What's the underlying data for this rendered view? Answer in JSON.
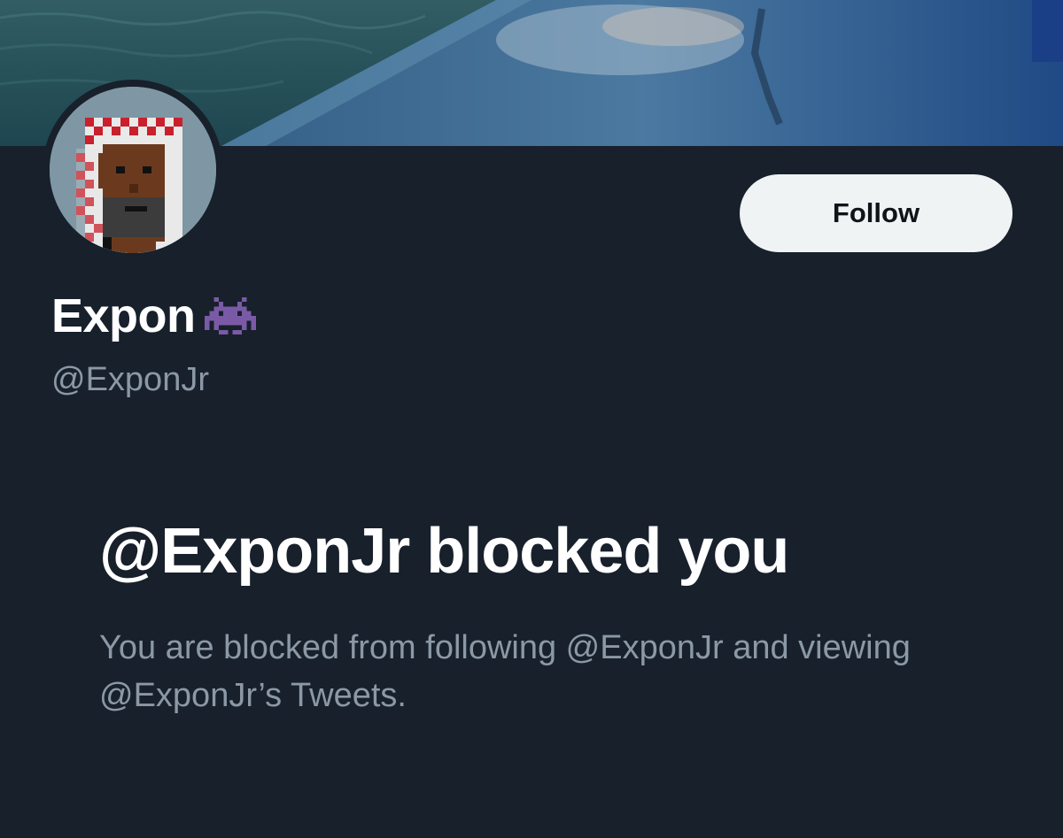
{
  "profile": {
    "display_name": "Expon",
    "name_emoji_icon": "alien-monster-icon",
    "handle": "@ExponJr",
    "follow_label": "Follow"
  },
  "blocked": {
    "title": "@ExponJr blocked you",
    "description": "You are blocked from following @ExponJr and viewing @ExponJr’s Tweets."
  },
  "colors": {
    "background": "#17202b",
    "primary_text": "#ffffff",
    "secondary_text": "#8b98a5",
    "follow_button_bg": "#eff3f4",
    "emoji_purple": "#7a5aa6"
  }
}
